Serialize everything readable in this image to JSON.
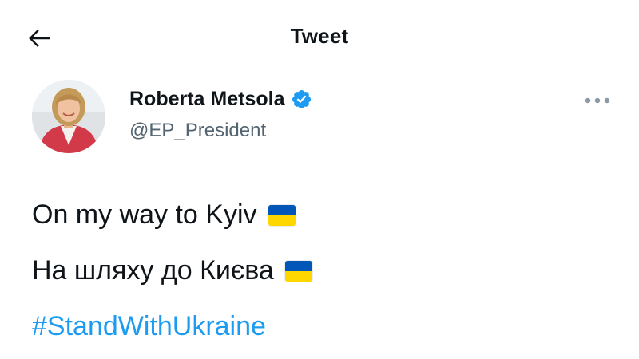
{
  "header": {
    "title": "Tweet",
    "back_icon": "arrow-left-icon"
  },
  "author": {
    "name": "Roberta Metsola",
    "handle": "@EP_President",
    "verified": true,
    "verified_color": "#1d9bf0"
  },
  "menu": {
    "icon": "more-horizontal-icon"
  },
  "tweet": {
    "line1": "On my way to Kyiv",
    "line2": "На шляху до Києва",
    "hashtag": "#StandWithUkraine",
    "flag_emoji": "ukraine-flag-icon"
  },
  "colors": {
    "link": "#1d9bf0",
    "text": "#0f1419",
    "secondary": "#536471",
    "flag_blue": "#0057b7",
    "flag_yellow": "#ffd700"
  }
}
